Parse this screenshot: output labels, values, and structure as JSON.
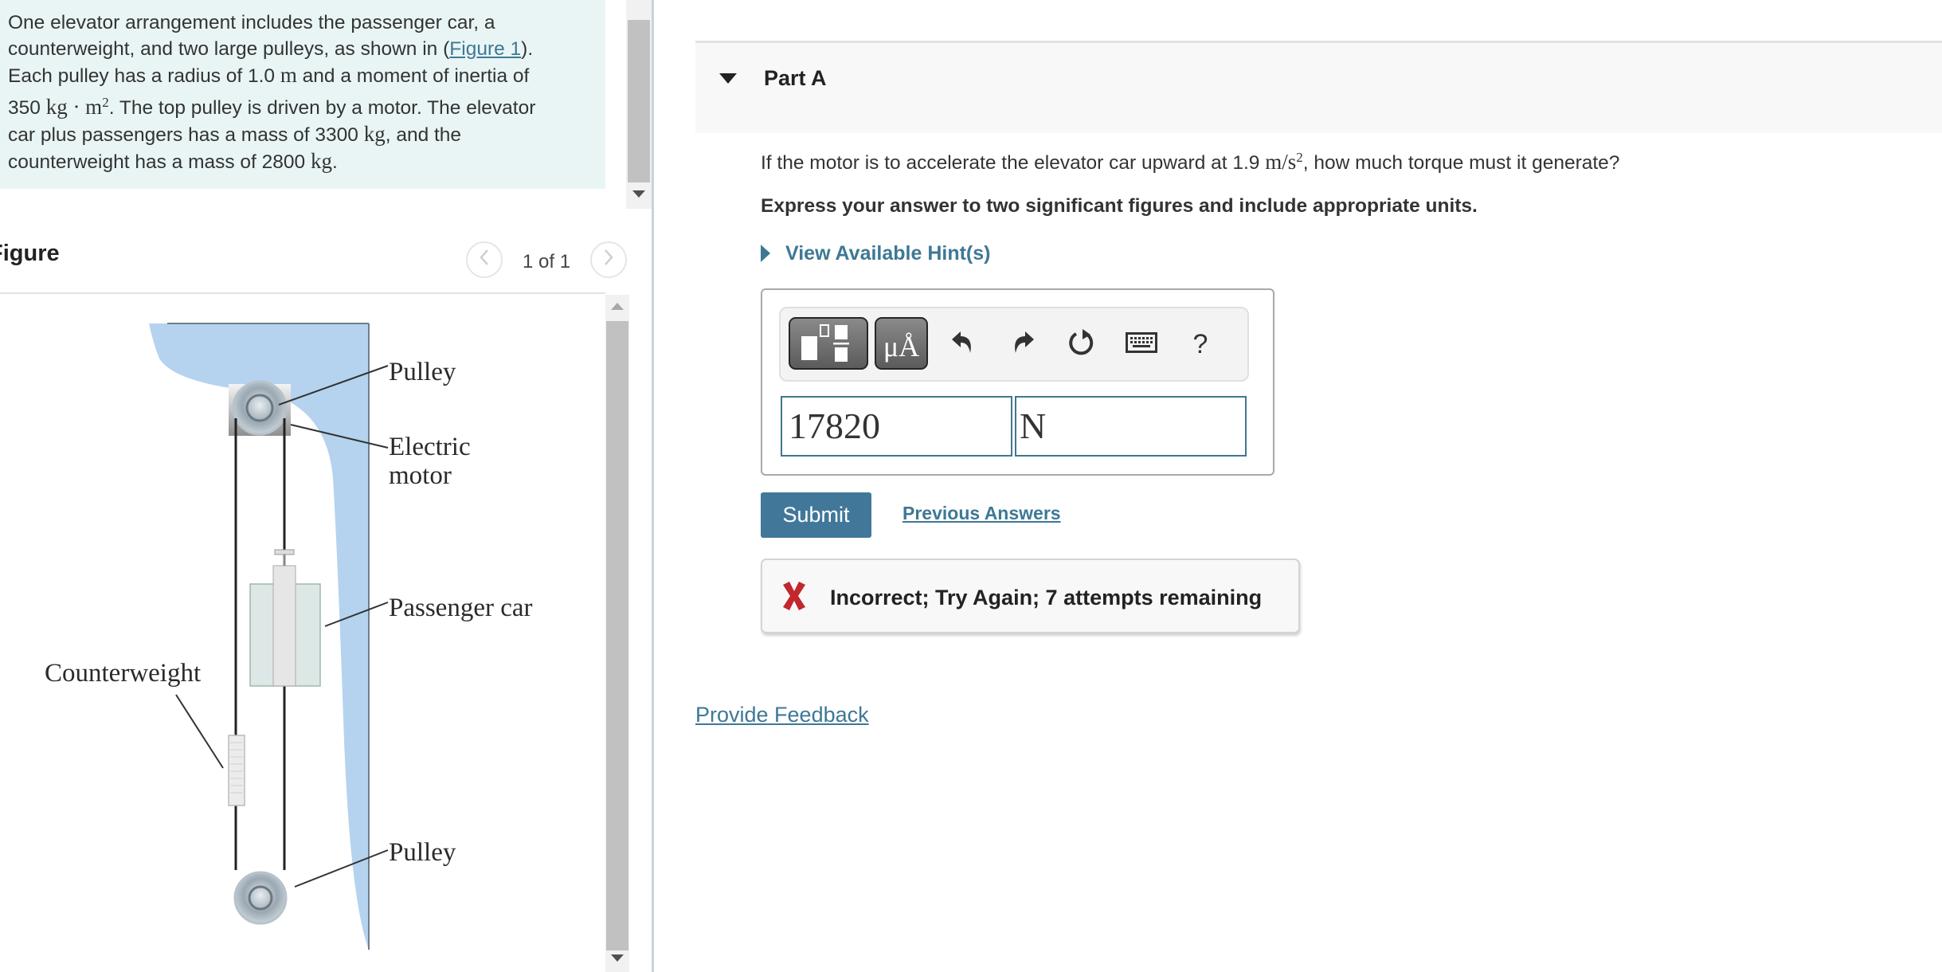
{
  "intro": {
    "lines": [
      [
        "One elevator arrangement includes the passenger car, a"
      ],
      [
        "counterweight, and two large pulleys, as shown in (",
        "Figure 1",
        ")."
      ],
      [
        "Each pulley has a radius of 1.0 ",
        "m",
        " and a moment of inertia of"
      ],
      [
        "350 ",
        "kg · m²",
        ". The top pulley is driven by a motor. The elevator"
      ],
      [
        "car plus passengers has a mass of 3300 ",
        "kg",
        ", and the"
      ],
      [
        "counterweight has a mass of 2800 ",
        "kg",
        "."
      ]
    ],
    "line1": "One elevator arrangement includes the passenger car, a",
    "line2_pre": "counterweight, and two large pulleys, as shown in (",
    "figure_link": "Figure 1",
    "line2_post": ").",
    "line3_pre": "Each pulley has a radius of 1.0 ",
    "line3_unit": "m",
    "line3_post": " and a moment of inertia of",
    "line4_pre": "350 ",
    "line4_unit": "kg · m",
    "line4_sup": "2",
    "line4_post": ". The top pulley is driven by a motor. The elevator",
    "line5_pre": "car plus passengers has a mass of 3300 ",
    "line5_unit": "kg",
    "line5_post": ", and the",
    "line6_pre": "counterweight has a mass of 2800 ",
    "line6_unit": "kg",
    "line6_post": "."
  },
  "figure": {
    "title": "Figure",
    "pager": "1 of 1",
    "prev_icon": "chevron-left-icon",
    "next_icon": "chevron-right-icon",
    "labels": {
      "top_pulley": "Pulley",
      "motor_line1": "Electric",
      "motor_line2": "motor",
      "passenger_car": "Passenger car",
      "counterweight": "Counterweight",
      "bottom_pulley": "Pulley"
    },
    "colors": {
      "shaft": "#b5d3ee",
      "car": "#dde8e6"
    }
  },
  "part": {
    "title": "Part A",
    "question_pre": "If the motor is to accelerate the elevator car upward at 1.9 ",
    "question_unit": "m/s",
    "question_sup": "2",
    "question_post": ", how much torque must it generate?",
    "instruction": "Express your answer to two significant figures and include appropriate units.",
    "hint_link": "View Available Hint(s)"
  },
  "toolbar": {
    "buttons": [
      "templates-icon",
      "units-icon",
      "undo-icon",
      "redo-icon",
      "reset-icon",
      "keyboard-icon",
      "help-icon"
    ],
    "units_label": "μÅ",
    "help_label": "?"
  },
  "answer": {
    "value": "17820",
    "unit": "N"
  },
  "actions": {
    "submit": "Submit",
    "previous_answers": "Previous Answers"
  },
  "feedback": {
    "status": "incorrect",
    "message": "Incorrect; Try Again; 7 attempts remaining",
    "color": "#c1272d"
  },
  "footer": {
    "provide_feedback": "Provide Feedback"
  }
}
